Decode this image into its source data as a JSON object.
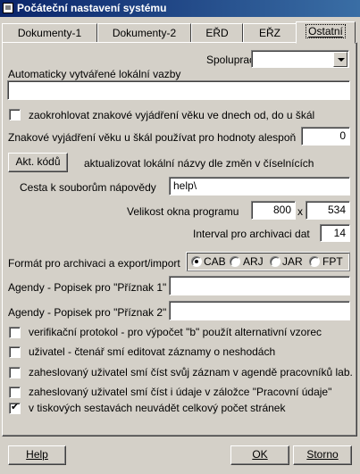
{
  "window": {
    "title": "Počáteční nastavení systému"
  },
  "tabs": [
    "Dokumenty-1",
    "Dokumenty-2",
    "EŘD",
    "EŘZ",
    "Ostatní"
  ],
  "active_tab": "Ostatní",
  "form": {
    "lis_label": "Spolupracující LIS",
    "lis_value": "",
    "auto_links_label": "Automaticky vytvářené lokální vazby",
    "auto_links_value": "",
    "round_age_label": "zaokrohlovat znakové vyjádření věku ve dnech od, do u škál",
    "round_age_checked": false,
    "age_threshold_label": "Znakové vyjádření věku u škál používat pro hodnoty alespoň",
    "age_threshold_value": "0",
    "akt_button": "Akt. kódů",
    "akt_desc": "aktualizovat lokální názvy dle změn v číselnících",
    "help_path_label": "Cesta k souborům nápovědy",
    "help_path_value": "help\\",
    "window_size_label": "Velikost okna programu",
    "window_width": "800",
    "window_size_sep": "x",
    "window_height": "534",
    "archive_interval_label": "Interval pro archivaci dat",
    "archive_interval_value": "14",
    "format_label": "Formát pro archivaci a export/import",
    "format_options": [
      "CAB",
      "ARJ",
      "JAR",
      "FPT"
    ],
    "format_selected": "CAB",
    "flag1_label": "Agendy - Popisek pro \"Příznak 1\"",
    "flag1_value": "",
    "flag2_label": "Agendy - Popisek pro \"Příznak 2\"",
    "flag2_value": "",
    "options": [
      {
        "label": "verifikační protokol - pro výpočet \"b\" použít alternativní vzorec",
        "checked": false
      },
      {
        "label": "uživatel - čtenář smí editovat záznamy o neshodách",
        "checked": false
      },
      {
        "label": "zaheslovaný uživatel smí číst svůj záznam v agendě pracovníků lab.",
        "checked": false
      },
      {
        "label": "zaheslovaný uživatel smí číst i údaje v záložce \"Pracovní údaje\"",
        "checked": false
      },
      {
        "label": "v tiskových sestavách neuvádět celkový počet stránek",
        "checked": true
      }
    ]
  },
  "buttons": {
    "help": "Help",
    "ok": "OK",
    "cancel": "Storno"
  },
  "colors": {
    "titlebar_start": "#0a246a",
    "titlebar_end": "#3a6ea5",
    "face": "#d4d0c8"
  }
}
